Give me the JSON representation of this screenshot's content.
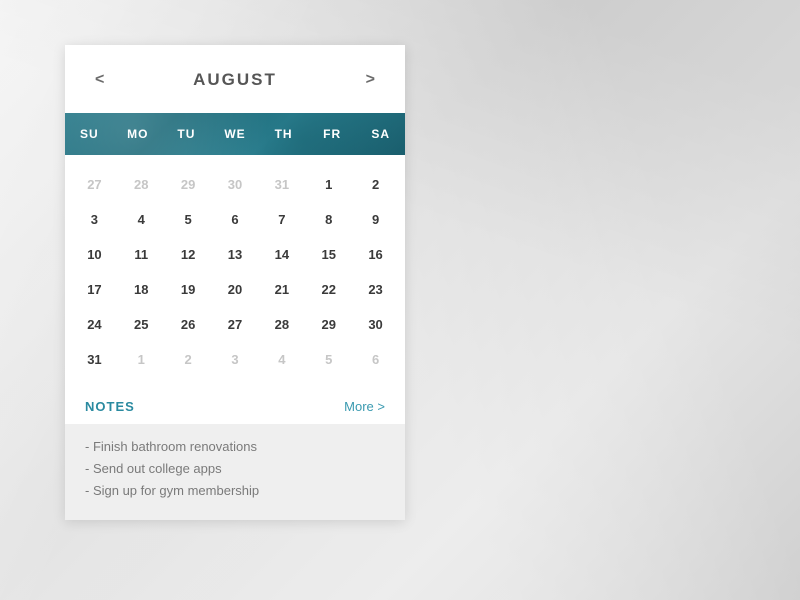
{
  "header": {
    "month": "AUGUST",
    "prev": "<",
    "next": ">"
  },
  "weekdays": [
    "SU",
    "MO",
    "TU",
    "WE",
    "TH",
    "FR",
    "SA"
  ],
  "days": [
    {
      "n": "27",
      "out": true
    },
    {
      "n": "28",
      "out": true
    },
    {
      "n": "29",
      "out": true
    },
    {
      "n": "30",
      "out": true
    },
    {
      "n": "31",
      "out": true
    },
    {
      "n": "1",
      "out": false
    },
    {
      "n": "2",
      "out": false
    },
    {
      "n": "3",
      "out": false
    },
    {
      "n": "4",
      "out": false
    },
    {
      "n": "5",
      "out": false
    },
    {
      "n": "6",
      "out": false
    },
    {
      "n": "7",
      "out": false
    },
    {
      "n": "8",
      "out": false
    },
    {
      "n": "9",
      "out": false
    },
    {
      "n": "10",
      "out": false
    },
    {
      "n": "11",
      "out": false
    },
    {
      "n": "12",
      "out": false
    },
    {
      "n": "13",
      "out": false
    },
    {
      "n": "14",
      "out": false
    },
    {
      "n": "15",
      "out": false
    },
    {
      "n": "16",
      "out": false
    },
    {
      "n": "17",
      "out": false
    },
    {
      "n": "18",
      "out": false
    },
    {
      "n": "19",
      "out": false
    },
    {
      "n": "20",
      "out": false
    },
    {
      "n": "21",
      "out": false
    },
    {
      "n": "22",
      "out": false
    },
    {
      "n": "23",
      "out": false
    },
    {
      "n": "24",
      "out": false
    },
    {
      "n": "25",
      "out": false
    },
    {
      "n": "26",
      "out": false
    },
    {
      "n": "27",
      "out": false
    },
    {
      "n": "28",
      "out": false
    },
    {
      "n": "29",
      "out": false
    },
    {
      "n": "30",
      "out": false
    },
    {
      "n": "31",
      "out": false
    },
    {
      "n": "1",
      "out": true
    },
    {
      "n": "2",
      "out": true
    },
    {
      "n": "3",
      "out": true
    },
    {
      "n": "4",
      "out": true
    },
    {
      "n": "5",
      "out": true
    },
    {
      "n": "6",
      "out": true
    }
  ],
  "notes": {
    "title": "NOTES",
    "more_label": "More >",
    "items": [
      "- Finish bathroom renovations",
      "- Send out college apps",
      "- Sign up for gym membership"
    ]
  }
}
